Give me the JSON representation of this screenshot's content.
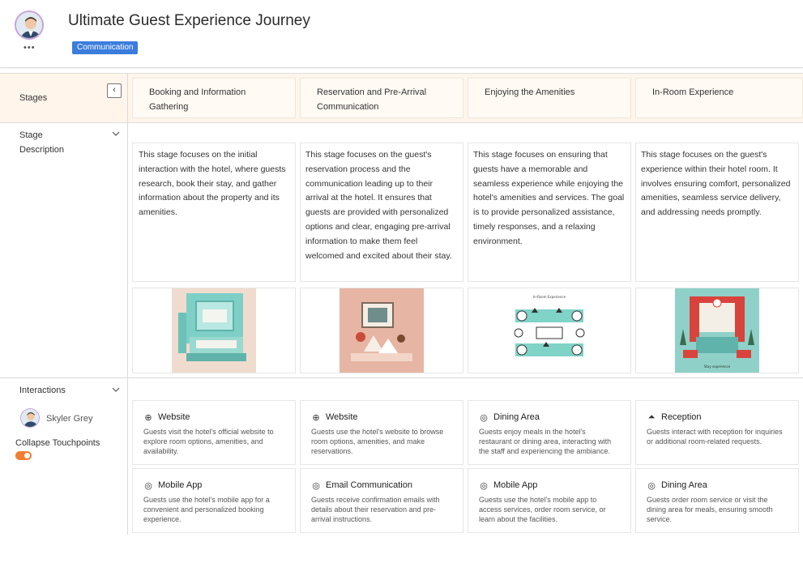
{
  "header": {
    "title": "Ultimate Guest Experience Journey",
    "tag": "Communication",
    "more": "•••"
  },
  "left": {
    "stages_label": "Stages",
    "collapse_icon": "‹",
    "stage_description_label": "Stage\nDescription",
    "interactions_label": "Interactions",
    "persona_name": "Skyler Grey",
    "collapse_touchpoints_label": "Collapse Touchpoints",
    "collapse_touchpoints_on": true
  },
  "stages": [
    {
      "title": "Booking and Information Gathering",
      "description": "This stage focuses on the initial interaction with the hotel, where guests research, book their stay, and gather information about the property and its amenities."
    },
    {
      "title": "Reservation and Pre-Arrival Communication",
      "description": "This stage focuses on the guest's reservation process and the communication leading up to their arrival at the hotel. It ensures that guests are provided with personalized options and clear, engaging pre-arrival information to make them feel welcomed and excited about their stay."
    },
    {
      "title": "Enjoying the Amenities",
      "description": "This stage focuses on ensuring that guests have a memorable and seamless experience while enjoying the hotel's amenities and services. The goal is to provide personalized assistance, timely responses, and a relaxing environment."
    },
    {
      "title": "In-Room Experience",
      "description": "This stage focuses on the guest's experience within their hotel room. It involves ensuring comfort, personalized amenities, seamless service delivery, and addressing needs promptly."
    }
  ],
  "touchpoints": [
    [
      {
        "icon": "globe-icon",
        "glyph": "⊕",
        "title": "Website",
        "desc": "Guests visit the hotel's official website to explore room options, amenities, and availability."
      },
      {
        "icon": "target-icon",
        "glyph": "◎",
        "title": "Mobile App",
        "desc": "Guests use the hotel's mobile app for a convenient and personalized booking experience."
      }
    ],
    [
      {
        "icon": "globe-icon",
        "glyph": "⊕",
        "title": "Website",
        "desc": "Guests use the hotel's website to browse room options, amenities, and make reservations."
      },
      {
        "icon": "target-icon",
        "glyph": "◎",
        "title": "Email Communication",
        "desc": "Guests receive confirmation emails with details about their reservation and pre-arrival instructions."
      }
    ],
    [
      {
        "icon": "target-icon",
        "glyph": "◎",
        "title": "Dining Area",
        "desc": "Guests enjoy meals in the hotel's restaurant or dining area, interacting with the staff and experiencing the ambiance."
      },
      {
        "icon": "target-icon",
        "glyph": "◎",
        "title": "Mobile App",
        "desc": "Guests use the hotel's mobile app to access services, order room service, or learn about the facilities."
      }
    ],
    [
      {
        "icon": "bell-icon",
        "glyph": "⏶",
        "title": "Reception",
        "desc": "Guests interact with reception for inquiries or additional room-related requests."
      },
      {
        "icon": "target-icon",
        "glyph": "◎",
        "title": "Dining Area",
        "desc": "Guests order room service or visit the dining area for meals, ensuring smooth service."
      }
    ]
  ],
  "image_labels": [
    "In-Room Experience",
    "Stay experience"
  ],
  "colors": {
    "tag_bg": "#3b7ddd",
    "stages_bg": "#fff5eb",
    "toggle": "#f08030"
  }
}
